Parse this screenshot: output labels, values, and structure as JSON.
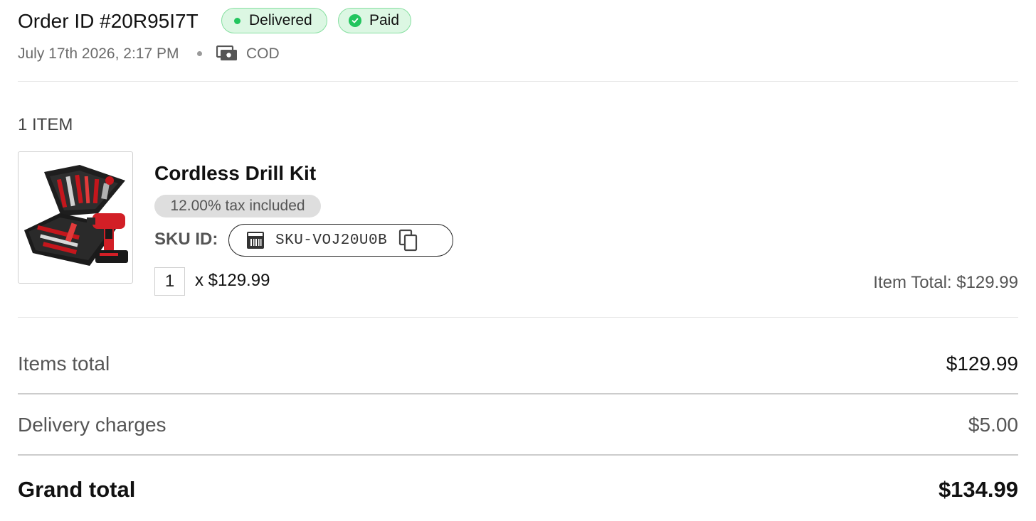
{
  "order": {
    "title": "Order ID #20R95I7T",
    "status_badge": "Delivered",
    "payment_badge": "Paid",
    "date": "July 17th 2026, 2:17 PM",
    "payment_method": "COD"
  },
  "items_section": {
    "count_label": "1 ITEM",
    "items": [
      {
        "name": "Cordless Drill Kit",
        "tax_note": "12.00% tax included",
        "sku_label": "SKU ID:",
        "sku": "SKU-VOJ20U0B",
        "quantity": "1",
        "unit_price": "x $129.99",
        "item_total": "Item Total: $129.99",
        "image_icon": "cordless-drill-kit-image"
      }
    ]
  },
  "summary": {
    "items_total_label": "Items total",
    "items_total_value": "$129.99",
    "delivery_label": "Delivery charges",
    "delivery_value": "$5.00",
    "grand_total_label": "Grand total",
    "grand_total_value": "$134.99"
  },
  "colors": {
    "badge_bg": "#dcf7e3",
    "badge_border": "#86dfa0",
    "success": "#22c55e",
    "tax_pill_bg": "#dedede"
  },
  "icons": {
    "payment_method_icon": "cash-icon",
    "sku_icon": "barcode-icon",
    "copy_icon": "copy-icon",
    "paid_icon": "check-circle-icon"
  }
}
